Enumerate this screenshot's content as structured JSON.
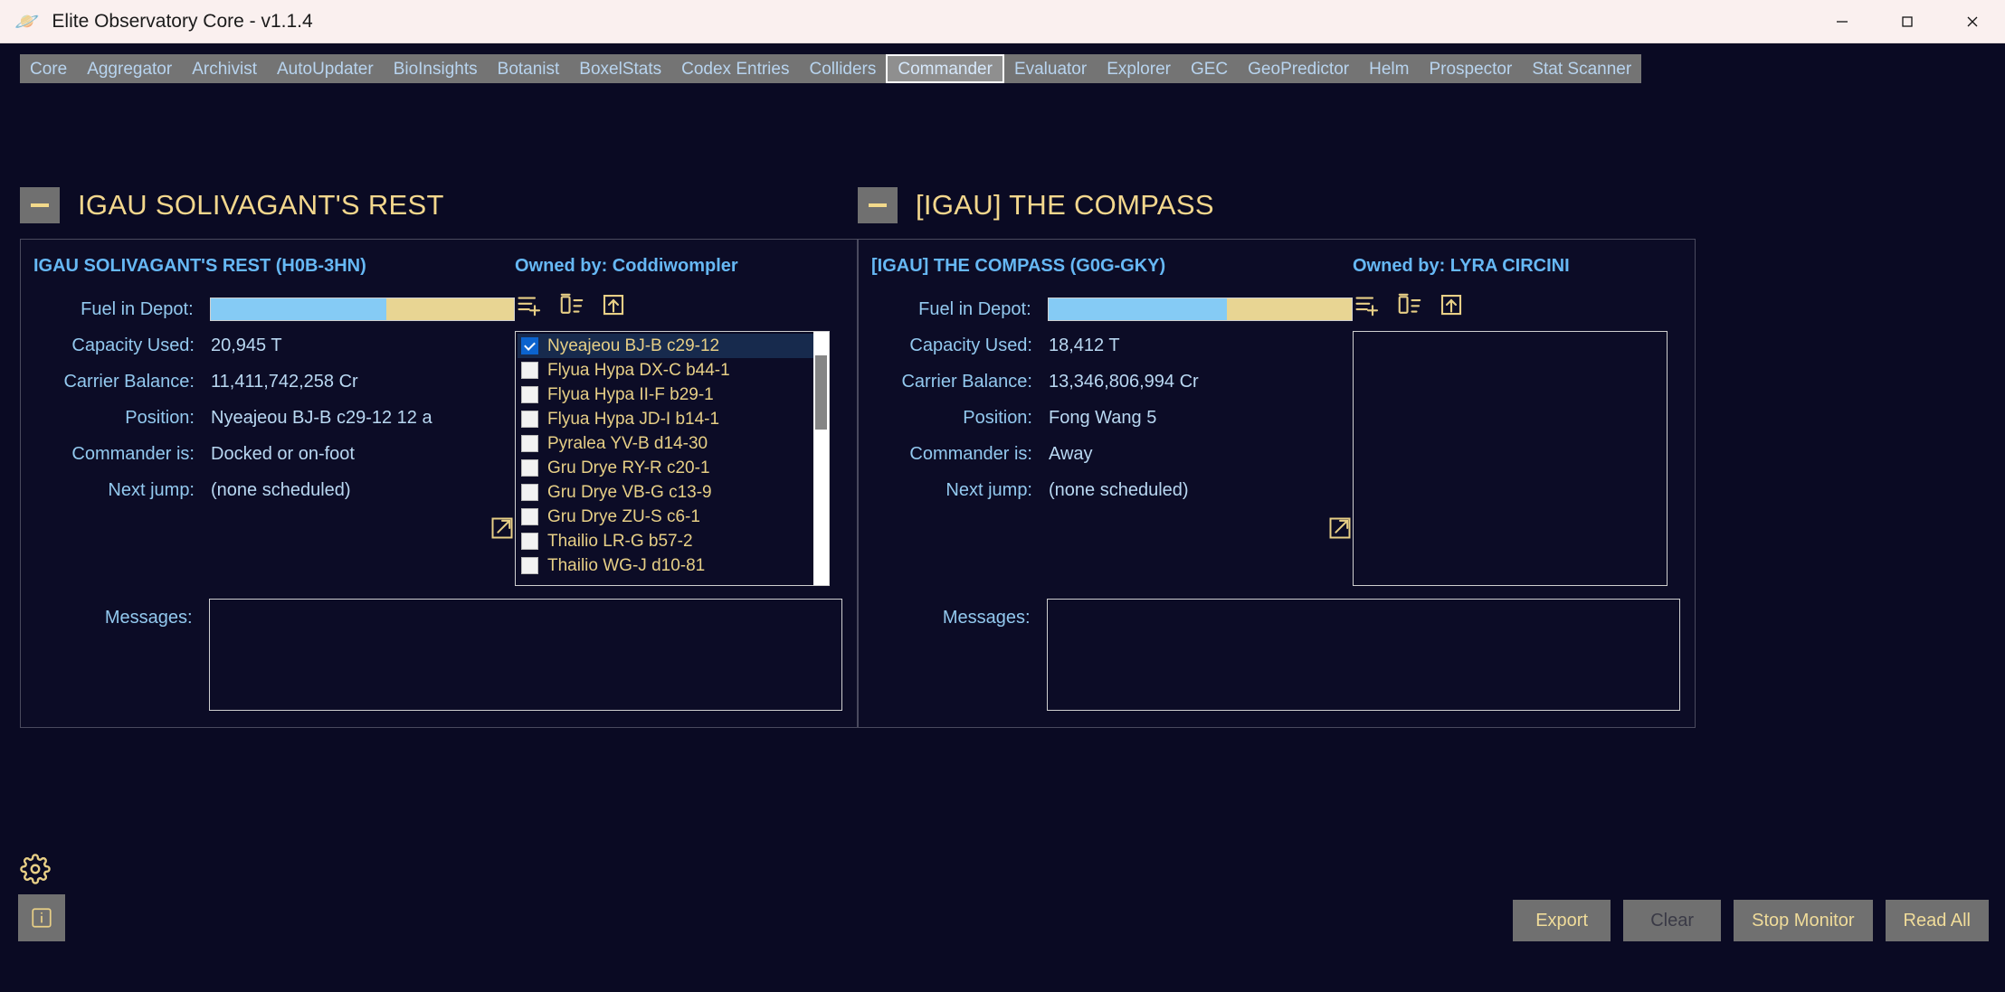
{
  "window": {
    "title": "Elite Observatory Core - v1.1.4",
    "app_icon": "planet-icon",
    "minimize_label": "Minimize",
    "maximize_label": "Maximize",
    "close_label": "Close"
  },
  "tabs": [
    {
      "label": "Core",
      "active": false
    },
    {
      "label": "Aggregator",
      "active": false
    },
    {
      "label": "Archivist",
      "active": false
    },
    {
      "label": "AutoUpdater",
      "active": false
    },
    {
      "label": "BioInsights",
      "active": false
    },
    {
      "label": "Botanist",
      "active": false
    },
    {
      "label": "BoxelStats",
      "active": false
    },
    {
      "label": "Codex Entries",
      "active": false
    },
    {
      "label": "Colliders",
      "active": false
    },
    {
      "label": "Commander",
      "active": true
    },
    {
      "label": "Evaluator",
      "active": false
    },
    {
      "label": "Explorer",
      "active": false
    },
    {
      "label": "GEC",
      "active": false
    },
    {
      "label": "GeoPredictor",
      "active": false
    },
    {
      "label": "Helm",
      "active": false
    },
    {
      "label": "Prospector",
      "active": false
    },
    {
      "label": "Stat Scanner",
      "active": false
    }
  ],
  "panels": [
    {
      "header_title": "IGAU SOLIVAGANT'S REST",
      "carrier_heading": "IGAU SOLIVAGANT'S REST (H0B-3HN)",
      "owner_heading": "Owned by: Coddiwompler",
      "fields": [
        {
          "label": "Fuel in Depot:",
          "value": "",
          "type": "bar"
        },
        {
          "label": "Capacity Used:",
          "value": "20,945 T",
          "type": "text"
        },
        {
          "label": "Carrier Balance:",
          "value": "11,411,742,258 Cr",
          "type": "text"
        },
        {
          "label": "Position:",
          "value": "Nyeajeou BJ-B c29-12 12 a",
          "type": "text"
        },
        {
          "label": "Commander is:",
          "value": "Docked or on-foot",
          "type": "text"
        },
        {
          "label": "Next jump:",
          "value": "(none scheduled)",
          "type": "text"
        }
      ],
      "fuel_percent": 58,
      "messages_label": "Messages:",
      "messages_value": "",
      "systems": [
        {
          "name": "Nyeajeou BJ-B c29-12",
          "checked": true
        },
        {
          "name": "Flyua Hypa DX-C b44-1",
          "checked": false
        },
        {
          "name": "Flyua Hypa II-F b29-1",
          "checked": false
        },
        {
          "name": "Flyua Hypa JD-I b14-1",
          "checked": false
        },
        {
          "name": "Pyralea YV-B d14-30",
          "checked": false
        },
        {
          "name": "Gru Drye RY-R c20-1",
          "checked": false
        },
        {
          "name": "Gru Drye VB-G c13-9",
          "checked": false
        },
        {
          "name": "Gru Drye ZU-S c6-1",
          "checked": false
        },
        {
          "name": "Thailio LR-G b57-2",
          "checked": false
        },
        {
          "name": "Thailio WG-J d10-81",
          "checked": false
        }
      ],
      "has_list": true
    },
    {
      "header_title": "[IGAU] THE COMPASS",
      "carrier_heading": "[IGAU] THE COMPASS (G0G-GKY)",
      "owner_heading": "Owned by: LYRA CIRCINI",
      "fields": [
        {
          "label": "Fuel in Depot:",
          "value": "",
          "type": "bar"
        },
        {
          "label": "Capacity Used:",
          "value": "18,412 T",
          "type": "text"
        },
        {
          "label": "Carrier Balance:",
          "value": "13,346,806,994 Cr",
          "type": "text"
        },
        {
          "label": "Position:",
          "value": "Fong Wang 5",
          "type": "text"
        },
        {
          "label": "Commander is:",
          "value": "Away",
          "type": "text"
        },
        {
          "label": "Next jump:",
          "value": "(none scheduled)",
          "type": "text"
        }
      ],
      "fuel_percent": 59,
      "messages_label": "Messages:",
      "messages_value": "",
      "systems": [],
      "has_list": false
    }
  ],
  "list_toolbar": [
    {
      "icon": "add-to-list-icon",
      "label": "Add system"
    },
    {
      "icon": "remove-from-list-icon",
      "label": "Remove system"
    },
    {
      "icon": "import-list-icon",
      "label": "Import list"
    }
  ],
  "popout_icon_label": "pop-out-icon",
  "footer": {
    "settings_icon": "gear-icon",
    "info_icon": "info-icon",
    "buttons": [
      {
        "label": "Export",
        "disabled": false
      },
      {
        "label": "Clear",
        "disabled": true
      },
      {
        "label": "Stop Monitor",
        "disabled": false
      },
      {
        "label": "Read All",
        "disabled": false
      }
    ]
  },
  "colors": {
    "background": "#0a0a23",
    "accent_gold": "#f3d78d",
    "accent_blue": "#66b8f5",
    "fuel_fill": "#85cbf5",
    "fuel_track": "#e8d593",
    "tab_bar": "#747474"
  }
}
